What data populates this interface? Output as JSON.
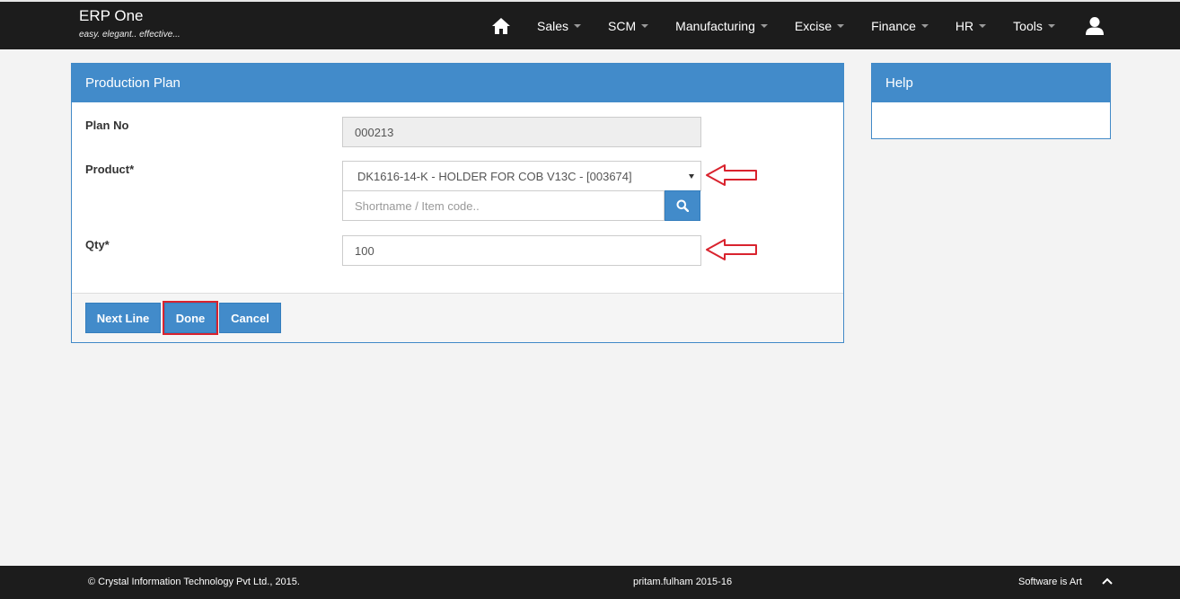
{
  "brand": {
    "title": "ERP One",
    "tagline": "easy. elegant.. effective..."
  },
  "nav": {
    "items": [
      {
        "label": "Sales"
      },
      {
        "label": "SCM"
      },
      {
        "label": "Manufacturing"
      },
      {
        "label": "Excise"
      },
      {
        "label": "Finance"
      },
      {
        "label": "HR"
      },
      {
        "label": "Tools"
      }
    ]
  },
  "panel": {
    "title": "Production Plan",
    "plan_no_label": "Plan No",
    "plan_no_value": "000213",
    "product_label": "Product*",
    "product_value": "DK1616-14-K - HOLDER FOR COB V13C - [003674]",
    "search_placeholder": "Shortname / Item code..",
    "qty_label": "Qty*",
    "qty_value": "100"
  },
  "buttons": {
    "next_line": "Next Line",
    "done": "Done",
    "cancel": "Cancel"
  },
  "help": {
    "title": "Help"
  },
  "footer": {
    "copyright": "© Crystal Information Technology Pvt Ltd., 2015.",
    "user": "pritam.fulham 2015-16",
    "slogan": "Software is Art"
  },
  "colors": {
    "primary": "#428bca",
    "navbar": "#1c1c1c",
    "annotation": "#d9232e"
  }
}
